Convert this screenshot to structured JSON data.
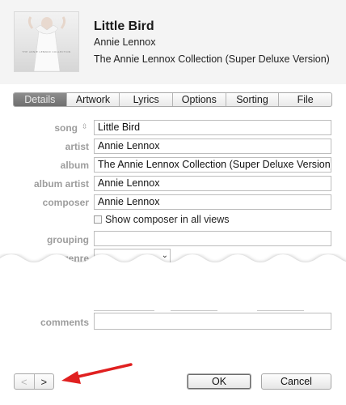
{
  "track": {
    "title": "Little Bird",
    "artist": "Annie Lennox",
    "album": "The Annie Lennox Collection (Super Deluxe Version)"
  },
  "tabs": [
    {
      "label": "Details",
      "active": true
    },
    {
      "label": "Artwork",
      "active": false
    },
    {
      "label": "Lyrics",
      "active": false
    },
    {
      "label": "Options",
      "active": false
    },
    {
      "label": "Sorting",
      "active": false
    },
    {
      "label": "File",
      "active": false
    }
  ],
  "fields": {
    "song": {
      "label": "song",
      "value": "Little Bird"
    },
    "artist": {
      "label": "artist",
      "value": "Annie Lennox"
    },
    "album": {
      "label": "album",
      "value": "The Annie Lennox Collection (Super Deluxe Version)"
    },
    "album_artist": {
      "label": "album artist",
      "value": "Annie Lennox"
    },
    "composer": {
      "label": "composer",
      "value": "Annie Lennox"
    },
    "grouping": {
      "label": "grouping",
      "value": ""
    },
    "genre": {
      "label": "genre",
      "value": ""
    },
    "comments": {
      "label": "comments",
      "value": ""
    }
  },
  "show_composer": {
    "label": "Show composer in all views",
    "checked": false
  },
  "buttons": {
    "prev": "<",
    "next": ">",
    "ok": "OK",
    "cancel": "Cancel"
  },
  "icons": {
    "sort": "sort-arrows-icon",
    "chevron": "chevron-down-icon",
    "annotation": "red-arrow-icon"
  },
  "colors": {
    "annotation_arrow": "#e02020",
    "active_tab": "#7b7b7b",
    "label_gray": "#9d9d9d"
  }
}
